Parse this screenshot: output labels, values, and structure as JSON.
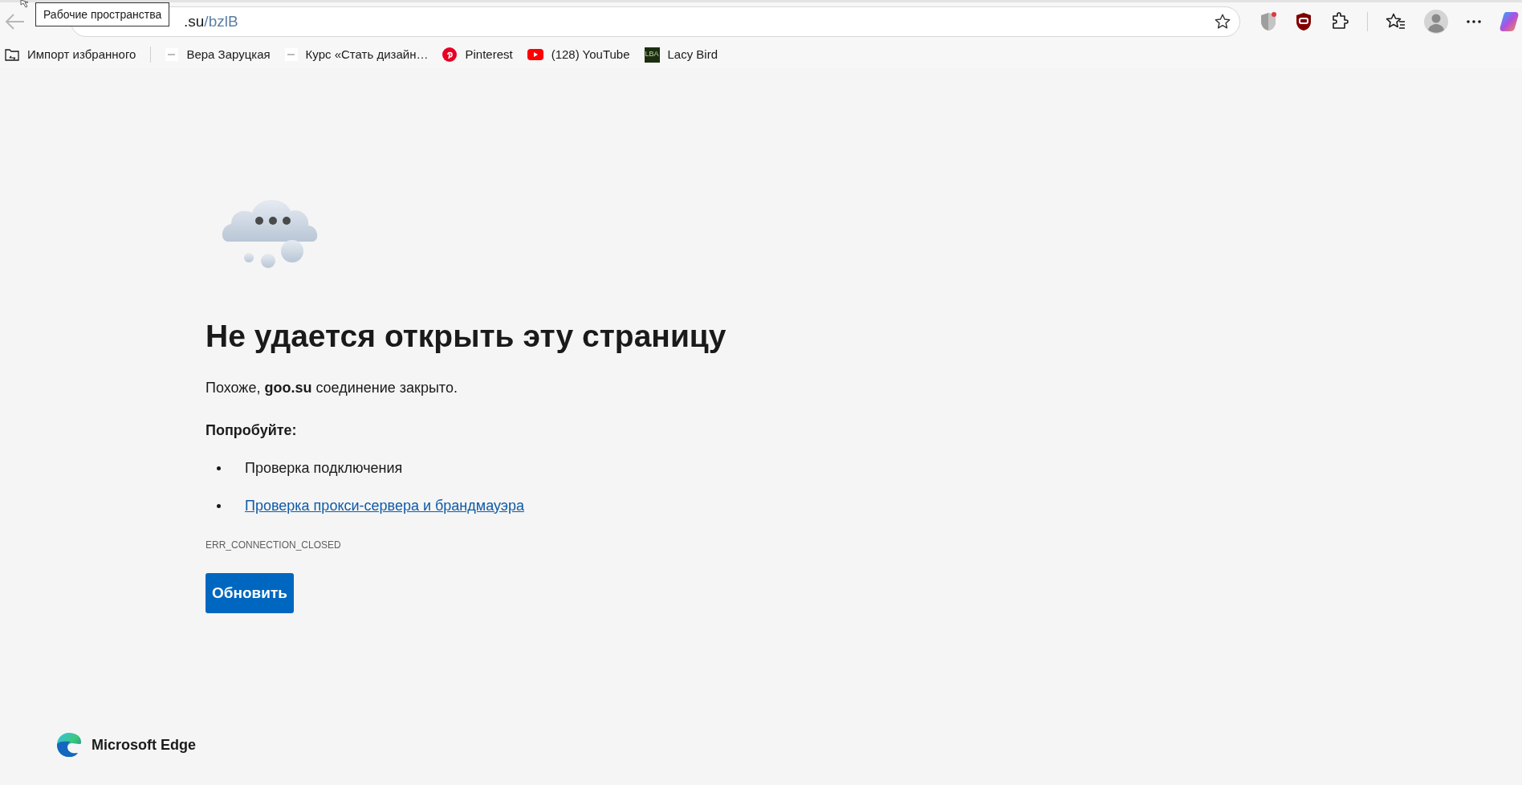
{
  "toolbar": {
    "tooltip": "Рабочие пространства",
    "address": {
      "host": ".su",
      "path": "/bzlB"
    }
  },
  "bookmarks": [
    {
      "label": "Импорт избранного",
      "kind": "import"
    },
    {
      "label": "Вера Заруцкая",
      "kind": "blank"
    },
    {
      "label": "Курс «Стать дизайн…",
      "kind": "blank"
    },
    {
      "label": "Pinterest",
      "kind": "pinterest"
    },
    {
      "label": "(128) YouTube",
      "kind": "youtube"
    },
    {
      "label": "Lacy Bird",
      "kind": "tile",
      "icon_text": "LBA"
    }
  ],
  "error": {
    "title": "Не удается открыть эту страницу",
    "message": "Похоже, **goo.su** соединение закрыто.",
    "try_label": "Попробуйте:",
    "suggestions": [
      {
        "text": "Проверка подключения",
        "kind": "text"
      },
      {
        "text": "Проверка прокси-сервера и брандмауэра",
        "kind": "link"
      }
    ],
    "code": "ERR_CONNECTION_CLOSED",
    "button": "Обновить"
  },
  "footer": {
    "brand": "Microsoft Edge"
  }
}
